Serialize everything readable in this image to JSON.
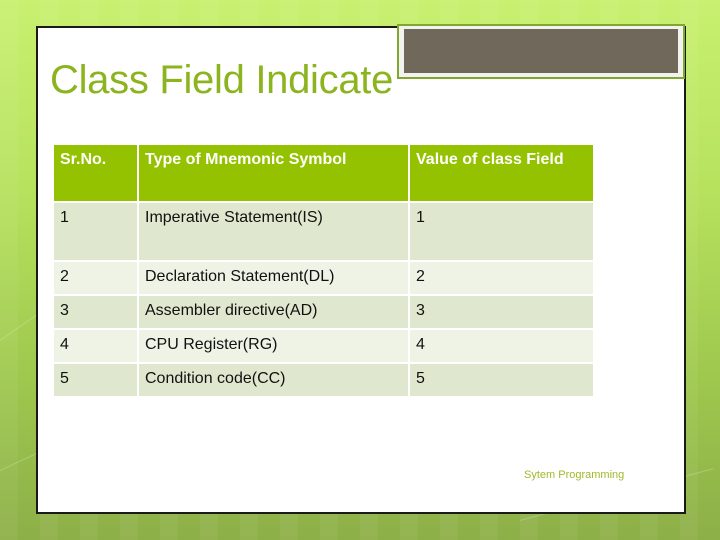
{
  "slide": {
    "title": "Class Field Indicate",
    "footer": "Sytem Programming"
  },
  "table": {
    "headers": [
      "Sr.No.",
      "Type of Mnemonic Symbol",
      "Value of class Field"
    ],
    "rows": [
      {
        "sr": "1",
        "type": "Imperative Statement(IS)",
        "value": "1"
      },
      {
        "sr": "2",
        "type": "Declaration Statement(DL)",
        "value": "2"
      },
      {
        "sr": "3",
        "type": "Assembler directive(AD)",
        "value": "3"
      },
      {
        "sr": "4",
        "type": "CPU Register(RG)",
        "value": "4"
      },
      {
        "sr": "5",
        "type": "Condition code(CC)",
        "value": "5"
      }
    ]
  },
  "colors": {
    "accent": "#94c200",
    "title": "#8cb41e",
    "header_box": "#70685a"
  }
}
